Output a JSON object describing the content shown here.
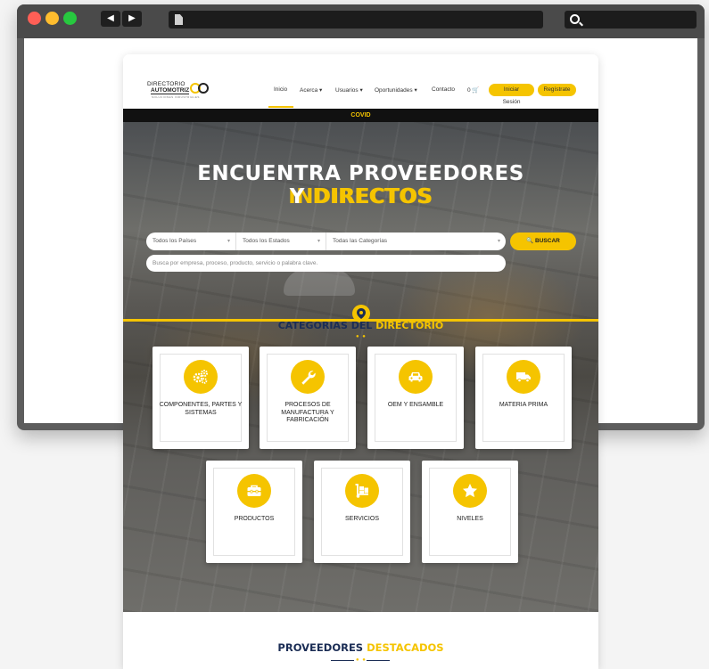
{
  "browser": {
    "back_glyph": "◀",
    "forward_glyph": "▶"
  },
  "colors": {
    "accent": "#f5c400",
    "navy": "#1b2d55",
    "dark": "#111111"
  },
  "logo": {
    "line1": "DIRECTORIO",
    "line2": "AUTOMOTRIZ",
    "line3": "SOLUCIONES INDUSTRIALES"
  },
  "nav": {
    "inicio": "Inicio",
    "acerca": "Acerca ▾",
    "usuarios": "Usuarios ▾",
    "oportunidades": "Oportunidades ▾",
    "contacto": "Contacto",
    "cart": "0 🛒",
    "login": "Iniciar Sesión",
    "register": "Regístrate"
  },
  "banner": {
    "covid": "COVID"
  },
  "hero": {
    "line1_white": "ENCUENTRA PROVEEDORES ",
    "line1_yellow": "INDIRECTOS",
    "line2_white": "Y ",
    "line2_yellow": "DIRECTOS"
  },
  "search": {
    "country": "Todos los Países",
    "state": "Todos los Estados",
    "category": "Todas las Categorías",
    "arrow": "▾",
    "button": "🔍 BUSCAR",
    "placeholder": "Busca por empresa, proceso, producto, servicio o palabra clave."
  },
  "categories_section": {
    "title_navy": "CATEGORIAS DEL ",
    "title_yellow": "DIRECTORIO",
    "dots": "● ●"
  },
  "categories": [
    {
      "label": "COMPONENTES, PARTES Y SISTEMAS",
      "icon": "gears-icon"
    },
    {
      "label": "PROCESOS DE MANUFACTURA Y FABRICACIÓN",
      "icon": "wrench-icon"
    },
    {
      "label": "OEM Y ENSAMBLE",
      "icon": "car-icon"
    },
    {
      "label": "MATERIA PRIMA",
      "icon": "truck-icon"
    },
    {
      "label": "PRODUCTOS",
      "icon": "toolbox-icon"
    },
    {
      "label": "SERVICIOS",
      "icon": "dolly-icon"
    },
    {
      "label": "NIVELES",
      "icon": "star-icon"
    }
  ],
  "featured": {
    "title_navy": "PROVEEDORES ",
    "title_yellow": "DESTACADOS",
    "dots": "● ●"
  }
}
